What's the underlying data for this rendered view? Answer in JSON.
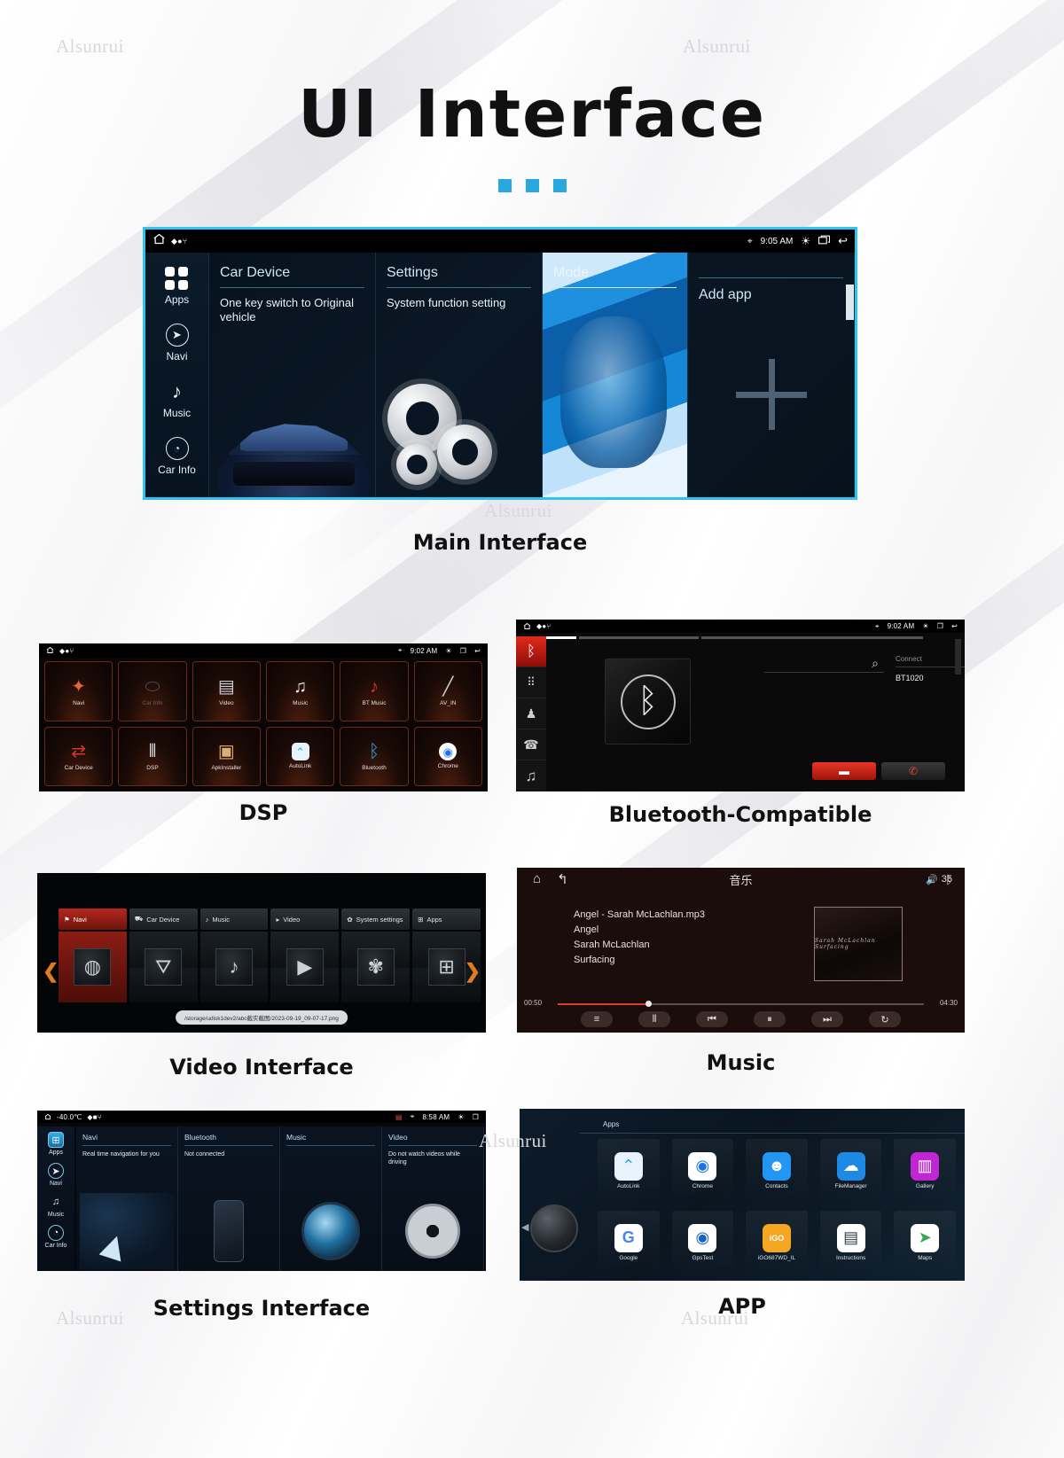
{
  "header": {
    "title_a": "UI",
    "title_b": "Interface",
    "dots": 3
  },
  "watermarks": [
    "Alsunrui",
    "Alsunrui",
    "Alsunrui",
    "Alsunrui",
    "Alsunrui",
    "Alsunrui"
  ],
  "captions": {
    "main": "Main Interface",
    "dsp": "DSP",
    "bluetooth": "Bluetooth-Compatible",
    "video": "Video Interface",
    "music": "Music",
    "settings": "Settings Interface",
    "app": "APP"
  },
  "main_interface": {
    "statusbar": {
      "home_icon": "home-icon",
      "indicators": "◆●⑂",
      "location_icon": "location-pin-icon",
      "time": "9:05 AM",
      "brightness_icon": "brightness-icon",
      "recents_icon": "recents-icon",
      "back_icon": "back-arrow-icon"
    },
    "rail": [
      {
        "label": "Apps",
        "icon": "apps-grid-icon"
      },
      {
        "label": "Navi",
        "icon": "navigation-icon"
      },
      {
        "label": "Music",
        "icon": "music-note-icon"
      },
      {
        "label": "Car Info",
        "icon": "car-info-icon"
      }
    ],
    "cards": [
      {
        "title": "Car Device",
        "subtitle": "One key switch to Original vehicle",
        "art": "car"
      },
      {
        "title": "Settings",
        "subtitle": "System function setting",
        "art": "gears"
      },
      {
        "title": "Mode",
        "subtitle": "",
        "art": "mode-image"
      },
      {
        "title": "Add app",
        "subtitle": "",
        "art": "plus"
      }
    ]
  },
  "dsp_interface": {
    "statusbar": {
      "indicators": "◆●⑂",
      "time": "9:02 AM"
    },
    "apps": [
      {
        "label": "Navi",
        "icon": "satellite-icon",
        "glyph": "🛰",
        "dim": false
      },
      {
        "label": "Car Info",
        "icon": "car-info-icon",
        "glyph": "☸",
        "dim": true
      },
      {
        "label": "Video",
        "icon": "clapperboard-icon",
        "glyph": "🎬",
        "dim": false
      },
      {
        "label": "Music",
        "icon": "music-note-icon",
        "glyph": "♫",
        "dim": false
      },
      {
        "label": "BT Music",
        "icon": "bt-music-icon",
        "glyph": "♪",
        "dim": false
      },
      {
        "label": "AV_IN",
        "icon": "av-in-icon",
        "glyph": "╱",
        "dim": false
      },
      {
        "label": "Car Device",
        "icon": "usb-transfer-icon",
        "glyph": "↻",
        "dim": false
      },
      {
        "label": "DSP",
        "icon": "equalizer-icon",
        "glyph": "‖",
        "dim": false
      },
      {
        "label": "ApkInstaller",
        "icon": "package-box-icon",
        "glyph": "📦",
        "dim": false
      },
      {
        "label": "AutoLink",
        "icon": "autolink-icon",
        "glyph": "⌃",
        "dim": false
      },
      {
        "label": "Bluetooth",
        "icon": "bluetooth-icon",
        "glyph": "ᛦ",
        "dim": false
      },
      {
        "label": "Chrome",
        "icon": "chrome-icon",
        "glyph": "◉",
        "dim": false
      }
    ]
  },
  "bluetooth_interface": {
    "statusbar": {
      "indicators": "◆●⑂",
      "time": "9:02 AM"
    },
    "rail": [
      {
        "icon": "bluetooth-icon",
        "glyph": "ᛦ",
        "active": true
      },
      {
        "icon": "dialpad-icon",
        "glyph": "∷",
        "active": false
      },
      {
        "icon": "contacts-icon",
        "glyph": "♟",
        "active": false
      },
      {
        "icon": "call-log-icon",
        "glyph": "☎",
        "active": false
      },
      {
        "icon": "bt-music-icon",
        "glyph": "♫",
        "active": false
      }
    ],
    "search_placeholder": "",
    "search_icon": "search-icon",
    "connect_header": "Connect",
    "devices": [
      "BT1020"
    ],
    "buttons": {
      "answer": "answer-call-button",
      "hangup": "hangup-call-button"
    },
    "center_icon": "bluetooth-logo-icon"
  },
  "video_interface": {
    "tabs": [
      {
        "label": "Navi",
        "icon": "flag-icon",
        "active": true
      },
      {
        "label": "Car Device",
        "icon": "car-icon",
        "active": false
      },
      {
        "label": "Music",
        "icon": "music-note-icon",
        "active": false
      },
      {
        "label": "Video",
        "icon": "play-circle-icon",
        "active": false
      },
      {
        "label": "System settings",
        "icon": "gear-icon",
        "active": false
      },
      {
        "label": "Apps",
        "icon": "apps-grid-icon",
        "active": false
      }
    ],
    "tiles": [
      {
        "icon": "map-thumb-icon",
        "glyph": "◎",
        "active": true
      },
      {
        "icon": "car-thumb-icon",
        "glyph": "🚗",
        "active": false
      },
      {
        "icon": "music-thumb-icon",
        "glyph": "♪",
        "active": false
      },
      {
        "icon": "video-thumb-icon",
        "glyph": "▶",
        "active": false
      },
      {
        "icon": "gear-thumb-icon",
        "glyph": "⚙",
        "active": false
      },
      {
        "icon": "apps-thumb-icon",
        "glyph": "⊞",
        "active": false
      }
    ],
    "prev_icon": "chevron-left-icon",
    "next_icon": "chevron-right-icon",
    "path": "/storage/udisk1dev2/abc截实截图/2023-09-19_09-07-17.png"
  },
  "music_interface": {
    "home_icon": "home-icon",
    "back_icon": "back-arrow-icon",
    "title": "音乐",
    "volume_icon": "volume-icon",
    "volume_value": "35",
    "bt_icon": "bluetooth-icon",
    "file": "Angel - Sarah McLachlan.mp3",
    "track": "Angel",
    "artist": "Sarah McLachlan",
    "album": "Surfacing",
    "album_art_caption": "Sarah McLachlan  Surfacing",
    "time_elapsed": "00:50",
    "time_total": "04:30",
    "controls": [
      {
        "icon": "playlist-icon",
        "glyph": "≡"
      },
      {
        "icon": "equalizer-icon",
        "glyph": "⫴"
      },
      {
        "icon": "previous-icon",
        "glyph": "⏮"
      },
      {
        "icon": "pause-icon",
        "glyph": "⏸"
      },
      {
        "icon": "next-icon",
        "glyph": "⏭"
      },
      {
        "icon": "repeat-icon",
        "glyph": "↺"
      }
    ]
  },
  "settings_interface": {
    "statusbar": {
      "temperature": "-40.0℃",
      "indicators": "◆■⑂",
      "time": "8:58 AM"
    },
    "rail": [
      {
        "label": "Apps",
        "icon": "apps-grid-icon",
        "glyph": "⊞",
        "active": true
      },
      {
        "label": "Navi",
        "icon": "navigation-icon",
        "glyph": "➤",
        "active": false
      },
      {
        "label": "Music",
        "icon": "music-note-icon",
        "glyph": "♫",
        "active": false
      },
      {
        "label": "Car Info",
        "icon": "car-info-icon",
        "glyph": "◔",
        "active": false
      }
    ],
    "cards": [
      {
        "title": "Navi",
        "text": "Real time navigation for you",
        "art": "map"
      },
      {
        "title": "Bluetooth",
        "text": "Not connected",
        "art": "phone"
      },
      {
        "title": "Music",
        "text": "",
        "art": "disc"
      },
      {
        "title": "Video",
        "text": "Do not watch videos while driving",
        "art": "film"
      }
    ]
  },
  "app_interface": {
    "header": "Apps",
    "knob_icon": "rotary-knob-icon",
    "apps": [
      {
        "label": "AutoLink",
        "icon": "autolink-icon",
        "glyph": "⌃",
        "bg": "#e8f2fa",
        "fg": "#2aa7e0"
      },
      {
        "label": "Chrome",
        "icon": "chrome-icon",
        "glyph": "◉",
        "bg": "#ffffff",
        "fg": "#1a73e8"
      },
      {
        "label": "Contacts",
        "icon": "contacts-icon",
        "glyph": "👤",
        "bg": "#2196f3",
        "fg": "#ffffff"
      },
      {
        "label": "FileManager",
        "icon": "filemanager-icon",
        "glyph": "☁",
        "bg": "#1e88e5",
        "fg": "#ffffff"
      },
      {
        "label": "Gallery",
        "icon": "gallery-icon",
        "glyph": "🖼",
        "bg": "#c026d3",
        "fg": "#ffffff"
      },
      {
        "label": "Google",
        "icon": "google-icon",
        "glyph": "G",
        "bg": "#ffffff",
        "fg": "#4285f4"
      },
      {
        "label": "GpsTest",
        "icon": "gpstest-icon",
        "glyph": "●",
        "bg": "#ffffff",
        "fg": "#1565c0"
      },
      {
        "label": "iGO687WD_IL",
        "icon": "igo-icon",
        "glyph": "iGO",
        "bg": "#f5a623",
        "fg": "#ffffff"
      },
      {
        "label": "Instructions",
        "icon": "instructions-icon",
        "glyph": "📖",
        "bg": "#ffffff",
        "fg": "#2b3a4a"
      },
      {
        "label": "Maps",
        "icon": "maps-icon",
        "glyph": "📍",
        "bg": "#ffffff",
        "fg": "#34a853"
      }
    ]
  },
  "colors": {
    "accent": "#29a8e0",
    "frame": "#2fc3f2",
    "red": "#e02a1c",
    "orange": "#e07b1f"
  }
}
